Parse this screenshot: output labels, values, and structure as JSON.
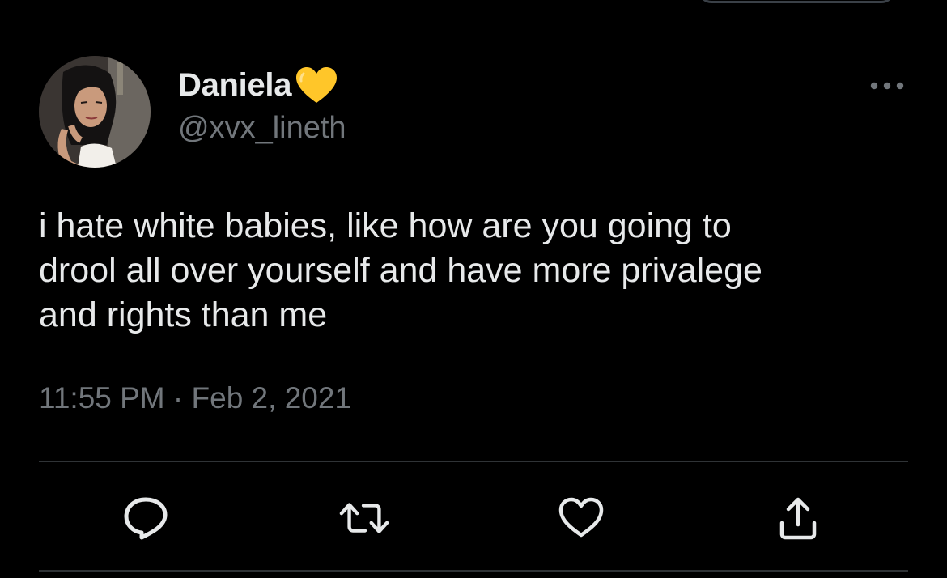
{
  "author": {
    "display_name": "Daniela",
    "handle": "@xvx_lineth",
    "name_emoji": "yellow-heart"
  },
  "tweet": {
    "text": "i hate white babies, like how are you going to\ndrool all over yourself and have more privalege\nand rights than me",
    "time": "11:55 PM",
    "separator": "·",
    "date": "Feb 2, 2021"
  },
  "actions": [
    {
      "name": "reply",
      "icon": "reply-icon"
    },
    {
      "name": "retweet",
      "icon": "retweet-icon"
    },
    {
      "name": "like",
      "icon": "heart-icon"
    },
    {
      "name": "share",
      "icon": "share-icon"
    }
  ],
  "colors": {
    "background": "#000000",
    "primary_text": "#e7e9ea",
    "secondary_text": "#71767b",
    "divider": "#2f3336",
    "heart_emoji": "#ffc629"
  }
}
